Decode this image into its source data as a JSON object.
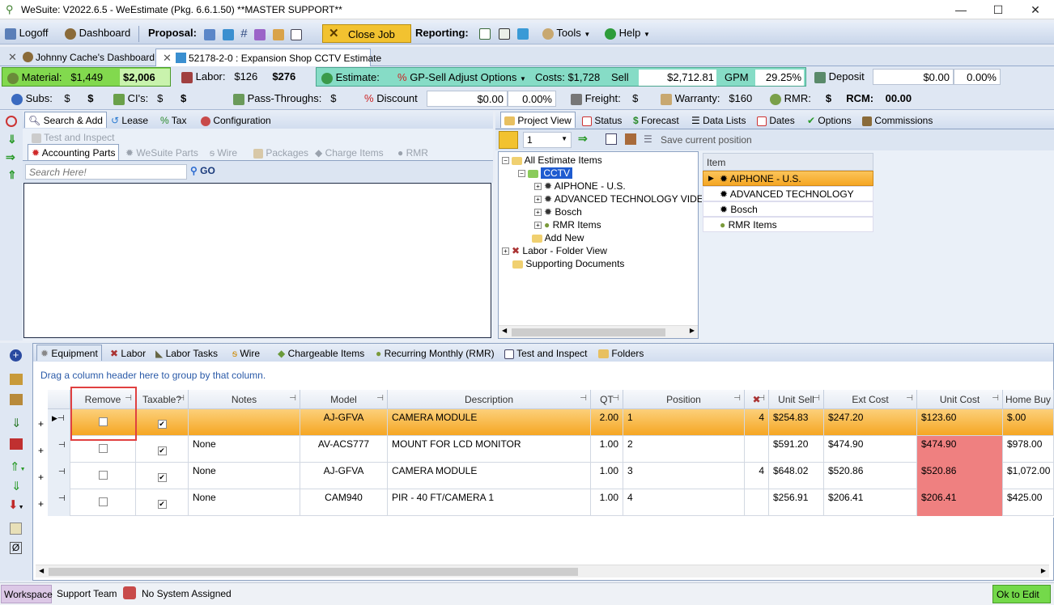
{
  "window": {
    "title": "WeSuite: V2022.6.5 - WeEstimate (Pkg. 6.6.1.50) **MASTER SUPPORT**"
  },
  "toolbar": {
    "logoff": "Logoff",
    "dashboard": "Dashboard",
    "proposal": "Proposal:",
    "close_job": "Close Job",
    "reporting": "Reporting:",
    "tools": "Tools",
    "help": "Help"
  },
  "doc_tabs": [
    "Johnny Cache's Dashboard",
    "52178-2-0 : Expansion Shop CCTV Estimate"
  ],
  "costs": {
    "material_label": "Material:",
    "material_cost": "$1,449",
    "material_sell": "$2,006",
    "labor_label": "Labor:",
    "labor_cost": "$126",
    "labor_sell": "$276",
    "estimate_label": "Estimate:",
    "gp_sell": "GP-Sell Adjust Options",
    "costs_text": "Costs: $1,728",
    "sell_label": "Sell",
    "sell_value": "$2,712.81",
    "gpm_label": "GPM",
    "gpm_value": "29.25%",
    "deposit_label": "Deposit",
    "deposit_value": "$0.00",
    "deposit_pct": "0.00%",
    "subs_label": "Subs:",
    "subs_a": "$",
    "subs_b": "$",
    "cis_label": "CI's:",
    "cis_a": "$",
    "cis_b": "$",
    "pass_label": "Pass-Throughs:",
    "pass_a": "$",
    "discount_label": "Discount",
    "discount_value": "$0.00",
    "discount_pct": "0.00%",
    "freight_label": "Freight:",
    "freight_a": "$",
    "warranty_label": "Warranty:",
    "warranty_value": "$160",
    "rmr_label": "RMR:",
    "rmr_a": "$",
    "rcm_label": "RCM:",
    "rcm_value": "00.00"
  },
  "left_panel": {
    "tabs": [
      "Search & Add",
      "Lease",
      "Tax",
      "Configuration"
    ],
    "sub_tabs": [
      "Test and Inspect",
      "Accounting Parts",
      "WeSuite Parts",
      "Wire",
      "Packages",
      "Charge Items",
      "RMR"
    ],
    "search_placeholder": "Search Here!",
    "go": "GO"
  },
  "right_panel": {
    "tabs": [
      "Project View",
      "Status",
      "Forecast",
      "Data Lists",
      "Dates",
      "Options",
      "Commissions"
    ],
    "qty": "1",
    "save_position": "Save current position",
    "tree": {
      "root": "All Estimate Items",
      "cctv": "CCTV",
      "children": [
        "AIPHONE - U.S.",
        "ADVANCED TECHNOLOGY VIDEO",
        "Bosch",
        "RMR Items"
      ],
      "add_new": "Add New",
      "labor": "Labor - Folder View",
      "supporting": "Supporting Documents"
    },
    "item_header": "Item",
    "items": [
      "AIPHONE - U.S.",
      "ADVANCED TECHNOLOGY VIDEO",
      "Bosch",
      "RMR Items"
    ]
  },
  "bottom": {
    "tabs": [
      "Equipment",
      "Labor",
      "Labor Tasks",
      "Wire",
      "Chargeable Items",
      "Recurring Monthly (RMR)",
      "Test and Inspect",
      "Folders"
    ],
    "group_hint": "Drag a column header here to group by that column.",
    "columns": [
      "Remove",
      "Taxable?",
      "Notes",
      "Model",
      "Description",
      "QT",
      "Position",
      "",
      "Unit Sell",
      "Ext Cost",
      "Unit Cost",
      "Home Buy"
    ],
    "rows": [
      {
        "notes": "",
        "model": "AJ-GFVA",
        "description": "CAMERA MODULE",
        "qt": "2.00",
        "position": "1",
        "pos2": "4",
        "unit_sell": "$254.83",
        "ext_cost": "$247.20",
        "unit_cost": "$123.60",
        "home_buy": "$.00"
      },
      {
        "notes": "None",
        "model": "AV-ACS777",
        "description": "MOUNT FOR LCD MONITOR",
        "qt": "1.00",
        "position": "2",
        "pos2": "",
        "unit_sell": "$591.20",
        "ext_cost": "$474.90",
        "unit_cost": "$474.90",
        "home_buy": "$978.00"
      },
      {
        "notes": "None",
        "model": "AJ-GFVA",
        "description": "CAMERA MODULE",
        "qt": "1.00",
        "position": "3",
        "pos2": "4",
        "unit_sell": "$648.02",
        "ext_cost": "$520.86",
        "unit_cost": "$520.86",
        "home_buy": "$1,072.00"
      },
      {
        "notes": "None",
        "model": "CAM940",
        "description": "PIR - 40 FT/CAMERA 1",
        "qt": "1.00",
        "position": "4",
        "pos2": "",
        "unit_sell": "$256.91",
        "ext_cost": "$206.41",
        "unit_cost": "$206.41",
        "home_buy": "$425.00"
      }
    ]
  },
  "status_bar": {
    "workspace": "Workspace",
    "team": "Support Team",
    "system": "No System Assigned",
    "ok_to_edit": "Ok to Edit"
  },
  "colors": {
    "accent": "#f7b24a",
    "highlight": "#ef8080",
    "ok": "#74d94a"
  }
}
